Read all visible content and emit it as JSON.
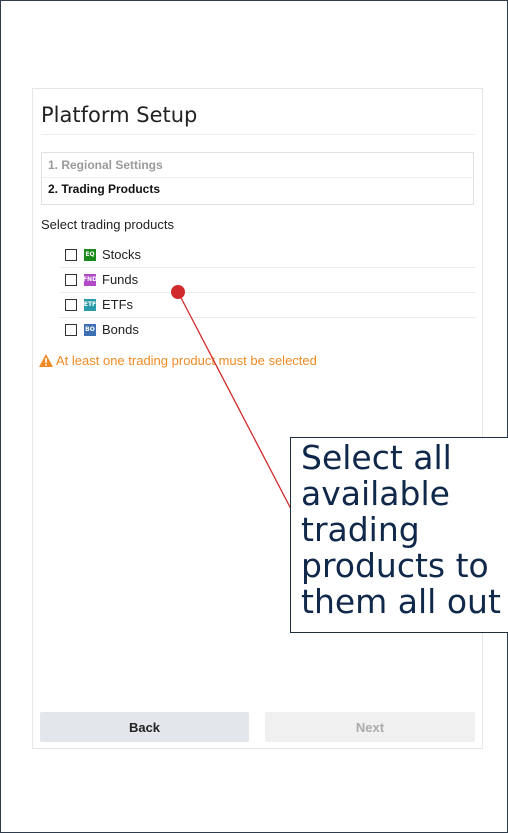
{
  "panel": {
    "title": "Platform Setup",
    "steps": [
      {
        "label": "1. Regional Settings"
      },
      {
        "label": "2. Trading Products"
      }
    ],
    "section_label": "Select trading products",
    "products": [
      {
        "badge": "EQ",
        "badge_color": "#1a8a1a",
        "label": "Stocks"
      },
      {
        "badge": "FND",
        "badge_color": "#b04ac6",
        "label": "Funds"
      },
      {
        "badge": "ETF",
        "badge_color": "#2a9aa8",
        "label": "ETFs"
      },
      {
        "badge": "BO",
        "badge_color": "#3d6fb6",
        "label": "Bonds"
      }
    ],
    "warning": "At least one trading product must be selected",
    "buttons": {
      "back": "Back",
      "next": "Next"
    }
  },
  "annotation": {
    "text": "Select all available trading products to them all out",
    "lines": [
      "Select all",
      "available",
      "trading",
      "products to",
      "them all out"
    ],
    "color": "#10284a",
    "pointer_color": "#d12a2a"
  }
}
